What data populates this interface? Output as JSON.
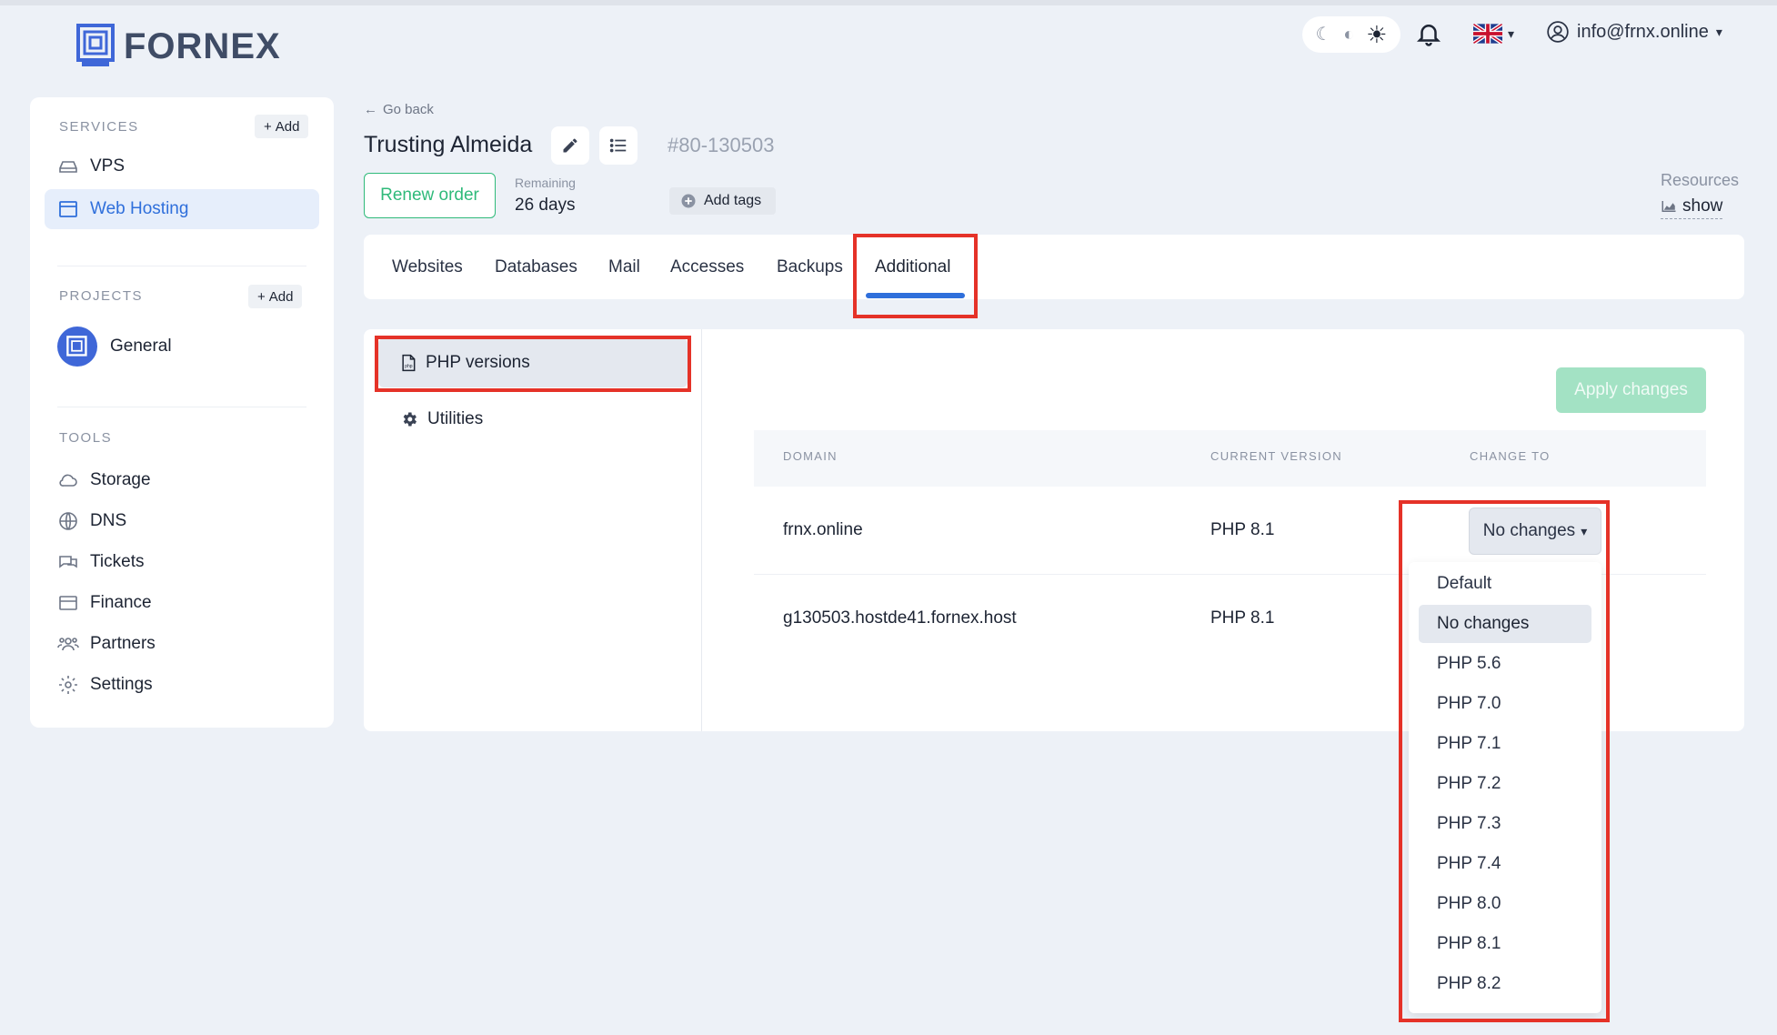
{
  "brand": {
    "name": "FORNEX"
  },
  "header": {
    "theme_icons": [
      "moon-icon",
      "half-moon-icon",
      "sun-icon"
    ],
    "notifications_icon": "bell-icon",
    "language_flag": "uk-flag-icon",
    "user_email": "info@frnx.online"
  },
  "sidebar": {
    "services_heading": "SERVICES",
    "services_add": "Add",
    "services": [
      {
        "label": "VPS",
        "icon": "server-icon",
        "active": false
      },
      {
        "label": "Web Hosting",
        "icon": "browser-icon",
        "active": true
      }
    ],
    "projects_heading": "PROJECTS",
    "projects_add": "Add",
    "projects": [
      {
        "label": "General",
        "icon": "project-logo-icon"
      }
    ],
    "tools_heading": "TOOLS",
    "tools": [
      {
        "label": "Storage",
        "icon": "cloud-icon"
      },
      {
        "label": "DNS",
        "icon": "globe-icon"
      },
      {
        "label": "Tickets",
        "icon": "chat-icon"
      },
      {
        "label": "Finance",
        "icon": "credit-card-icon"
      },
      {
        "label": "Partners",
        "icon": "people-icon"
      },
      {
        "label": "Settings",
        "icon": "gear-icon"
      }
    ]
  },
  "order": {
    "go_back": "Go back",
    "title": "Trusting Almeida",
    "number": "80-130503",
    "renew_label": "Renew order",
    "remaining_label": "Remaining",
    "remaining_value": "26 days",
    "add_tags": "Add tags",
    "resources_label": "Resources",
    "resources_show": "show"
  },
  "tabs": [
    {
      "label": "Websites",
      "active": false
    },
    {
      "label": "Databases",
      "active": false
    },
    {
      "label": "Mail",
      "active": false
    },
    {
      "label": "Accesses",
      "active": false
    },
    {
      "label": "Backups",
      "active": false
    },
    {
      "label": "Additional",
      "active": true
    }
  ],
  "subnav": [
    {
      "label": "PHP versions",
      "icon": "php-file-icon",
      "active": true
    },
    {
      "label": "Utilities",
      "icon": "gear-icon",
      "active": false
    }
  ],
  "php_table": {
    "apply_label": "Apply changes",
    "columns": [
      "DOMAIN",
      "CURRENT VERSION",
      "CHANGE TO"
    ],
    "rows": [
      {
        "domain": "frnx.online",
        "current": "PHP 8.1",
        "change_to": "No changes"
      },
      {
        "domain": "g130503.hostde41.fornex.host",
        "current": "PHP 8.1",
        "change_to": ""
      }
    ],
    "dropdown_options": [
      "Default",
      "No changes",
      "PHP 5.6",
      "PHP 7.0",
      "PHP 7.1",
      "PHP 7.2",
      "PHP 7.3",
      "PHP 7.4",
      "PHP 8.0",
      "PHP 8.1",
      "PHP 8.2"
    ],
    "dropdown_selected": "No changes"
  },
  "colors": {
    "accent": "#2f6fdb",
    "success": "#2fba7a",
    "highlight": "#e53228",
    "background": "#edf1f7"
  }
}
